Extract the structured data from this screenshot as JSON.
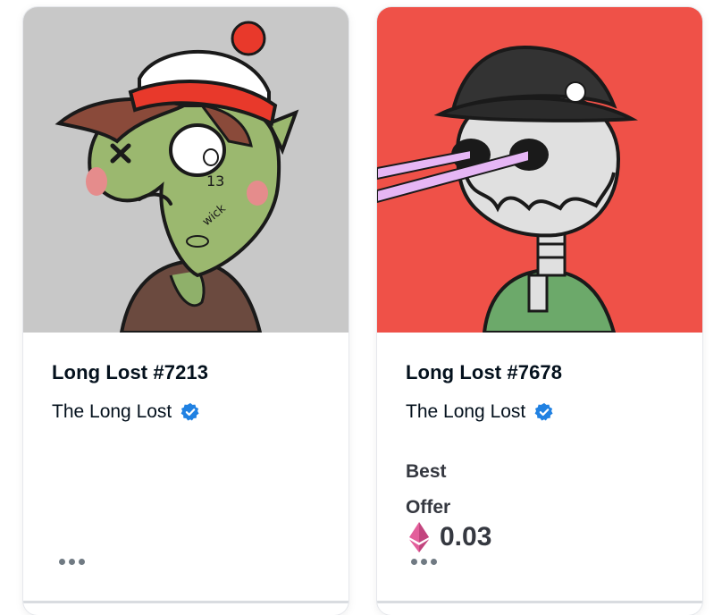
{
  "cards": [
    {
      "title": "Long Lost #7213",
      "collection": "The Long Lost",
      "verified_icon": "verified-badge-icon",
      "art_background": "#c8c8c8",
      "more_icon": "more-dots-icon"
    },
    {
      "title": "Long Lost #7678",
      "collection": "The Long Lost",
      "verified_icon": "verified-badge-icon",
      "art_background": "#ef5148",
      "price_label": "Best Offer",
      "price_value": "0.03",
      "currency_icon": "ethereum-icon",
      "more_icon": "more-dots-icon"
    }
  ],
  "colors": {
    "text_primary": "#04111d",
    "text_secondary": "#353840",
    "verified_blue": "#2081e2",
    "eth_pink": "#e35f9b"
  }
}
